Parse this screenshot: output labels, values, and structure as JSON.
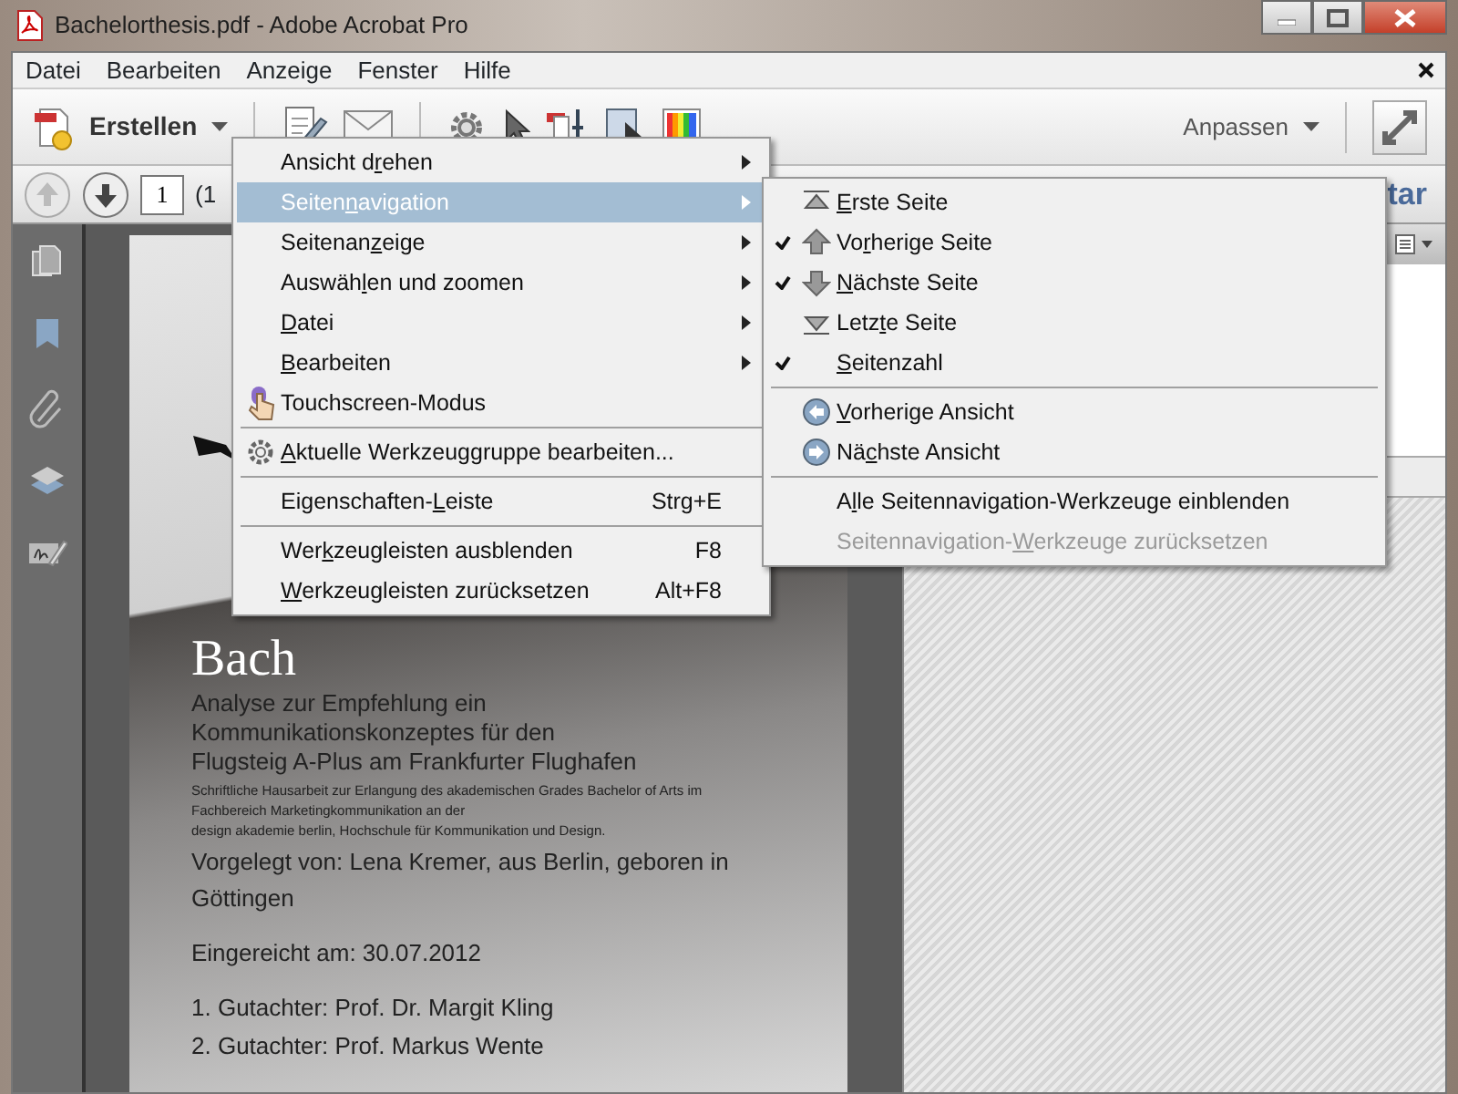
{
  "window": {
    "title": "Bachelorthesis.pdf - Adobe Acrobat Pro"
  },
  "menu_bar": [
    "Datei",
    "Bearbeiten",
    "Anzeige",
    "Fenster",
    "Hilfe"
  ],
  "toolbar": {
    "create_button": "Erstellen",
    "customize_button": "Anpassen"
  },
  "page_navigation": {
    "page_number": "1",
    "page_count": "(1",
    "panel_tab": "tar"
  },
  "context_menu": {
    "items": [
      {
        "kind": "submenu",
        "before": "Ansicht d",
        "mnemonic": "r",
        "after": "ehen",
        "selected": false
      },
      {
        "kind": "submenu",
        "before": "Seiten",
        "mnemonic": "n",
        "after": "avigation",
        "selected": true
      },
      {
        "kind": "submenu",
        "before": "Seitenan",
        "mnemonic": "z",
        "after": "eige",
        "selected": false
      },
      {
        "kind": "submenu",
        "before": "Auswäh",
        "mnemonic": "l",
        "after": "en und zoomen",
        "selected": false
      },
      {
        "kind": "submenu",
        "mnemonic": "D",
        "after": "atei",
        "selected": false
      },
      {
        "kind": "submenu",
        "mnemonic": "B",
        "after": "earbeiten",
        "selected": false
      },
      {
        "kind": "touch",
        "before": "Touchscreen-Modus",
        "selected": false
      },
      {
        "kind": "separator"
      },
      {
        "kind": "tool_group",
        "mnemonic": "A",
        "after": "ktuelle Werkzeuggruppe bearbeiten...",
        "selected": false
      },
      {
        "kind": "separator"
      },
      {
        "kind": "command",
        "before": "Eigenschaften-",
        "mnemonic": "L",
        "after": "eiste",
        "shortcut": "Strg+E",
        "selected": false
      },
      {
        "kind": "separator"
      },
      {
        "kind": "command",
        "before": "Wer",
        "mnemonic": "k",
        "after": "zeugleisten ausblenden",
        "shortcut": "F8",
        "selected": false
      },
      {
        "kind": "command",
        "mnemonic": "W",
        "after": "erkzeugleisten zurücksetzen",
        "shortcut": "Alt+F8",
        "selected": false
      }
    ]
  },
  "submenu": {
    "items": [
      {
        "kind": "first_page",
        "mnemonic": "E",
        "after": "rste Seite",
        "checked": false,
        "disabled": false
      },
      {
        "kind": "prev_page",
        "before": "Vo",
        "mnemonic": "r",
        "after": "herige Seite",
        "checked": true,
        "disabled": false
      },
      {
        "kind": "next_page",
        "mnemonic": "N",
        "after": "ächste Seite",
        "checked": true,
        "disabled": false
      },
      {
        "kind": "last_page",
        "before": "Letz",
        "mnemonic": "t",
        "after": "e Seite",
        "checked": false,
        "disabled": false
      },
      {
        "kind": "page_number",
        "mnemonic": "S",
        "after": "eitenzahl",
        "checked": true,
        "disabled": false
      },
      {
        "kind": "separator"
      },
      {
        "kind": "prev_view",
        "mnemonic": "V",
        "after": "orherige Ansicht",
        "checked": false,
        "disabled": false
      },
      {
        "kind": "next_view",
        "before": "Nä",
        "mnemonic": "c",
        "after": "hste Ansicht",
        "checked": false,
        "disabled": false
      },
      {
        "kind": "separator"
      },
      {
        "kind": "action",
        "before": "A",
        "mnemonic": "l",
        "after": "le Seitennavigation-Werkzeuge einblenden",
        "checked": false,
        "disabled": false
      },
      {
        "kind": "action",
        "before": "Seitennavigation-",
        "mnemonic": "W",
        "after": "erkzeuge zurücksetzen",
        "checked": false,
        "disabled": true
      }
    ]
  },
  "document": {
    "lines": [
      {
        "kind": "title",
        "text": "Bach"
      },
      {
        "kind": "heading",
        "text": "Analyse zur Empfehlung ein"
      },
      {
        "kind": "heading",
        "text": "Kommunikationskonzeptes für den"
      },
      {
        "kind": "heading",
        "text": "Flugsteig A-Plus am Frankfurter Flughafen"
      },
      {
        "kind": "fine",
        "text": "Schriftliche Hausarbeit zur Erlangung des akademischen Grades Bachelor of Arts im"
      },
      {
        "kind": "fine",
        "text": "Fachbereich Marketingkommunikation an der"
      },
      {
        "kind": "fine",
        "text": "design akademie berlin, Hochschule für Kommunikation und Design."
      },
      {
        "kind": "body",
        "text": "Vorgelegt von: Lena Kremer, aus Berlin, geboren in"
      },
      {
        "kind": "body",
        "text": "Göttingen"
      },
      {
        "kind": "gap"
      },
      {
        "kind": "body",
        "text": "Eingereicht am: 30.07.2012"
      },
      {
        "kind": "gap"
      },
      {
        "kind": "body",
        "text": "1. Gutachter: Prof. Dr. Margit Kling"
      },
      {
        "kind": "body",
        "text": "2. Gutachter: Prof. Markus Wente"
      }
    ]
  }
}
